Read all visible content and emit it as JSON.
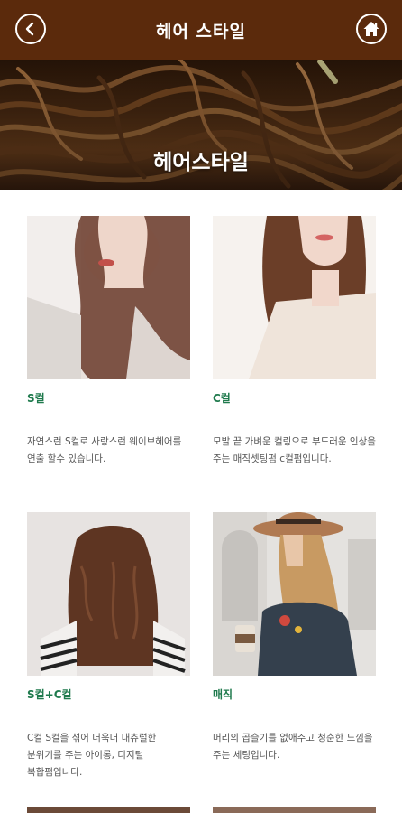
{
  "header": {
    "title": "헤어 스타일",
    "back_icon": "chevron-left-icon",
    "home_icon": "home-icon",
    "bar_color": "#5b2a0c"
  },
  "hero": {
    "title": "헤어스타일"
  },
  "styles": [
    {
      "name": "S컬",
      "description": "자연스런 S컬로 사랑스런 웨이브헤어를 연출 할수 있습니다."
    },
    {
      "name": "C컬",
      "description": "모발 끝 가벼운 컬링으로 부드러운 인상을 주는 매직셋팅펌 c컬펌입니다."
    },
    {
      "name": "S컬+C컬",
      "description": "C컬 S컬을 섞어 더욱더 내츄럴한 분위기를 주는 아이롱, 디지털 복합펌입니다."
    },
    {
      "name": "매직",
      "description": "머리의 곱슬기를 없애주고 청순한 느낌을 주는 세팅입니다."
    }
  ],
  "accent_color": "#1f7a4d"
}
